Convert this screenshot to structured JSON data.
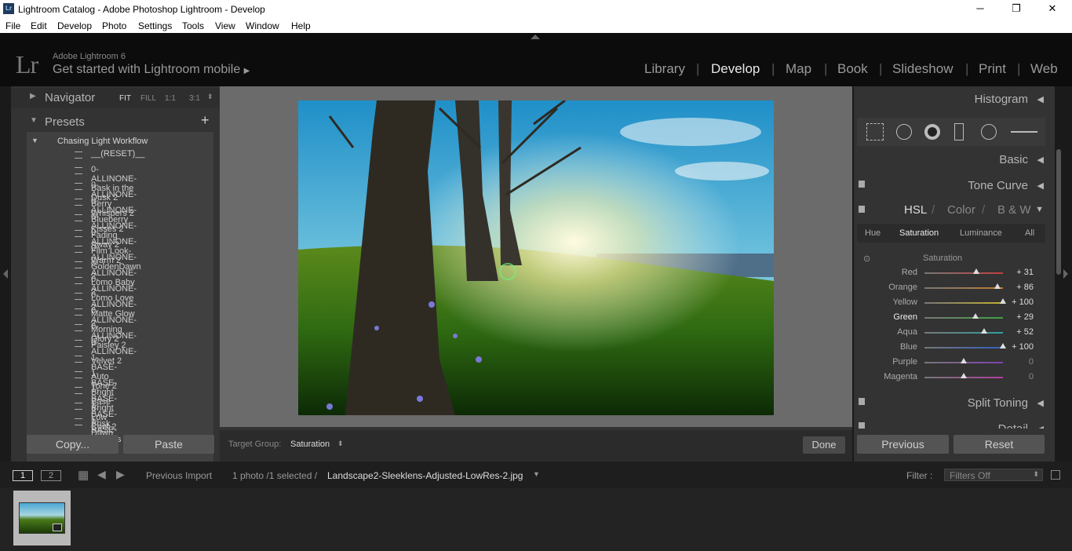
{
  "window": {
    "title": "Lightroom Catalog - Adobe Photoshop Lightroom - Develop",
    "min": "─",
    "max": "❐",
    "close": "✕"
  },
  "menu": [
    "File",
    "Edit",
    "Develop",
    "Photo",
    "Settings",
    "Tools",
    "View",
    "Window",
    "Help"
  ],
  "identity": {
    "logo": "Lr",
    "line1": "Adobe Lightroom 6",
    "line2": "Get started with Lightroom mobile",
    "arrow": "▶"
  },
  "modules": [
    "Library",
    "Develop",
    "Map",
    "Book",
    "Slideshow",
    "Print",
    "Web"
  ],
  "navigator": {
    "label": "Navigator",
    "zoom": [
      "FIT",
      "FILL",
      "1:1",
      "3:1"
    ]
  },
  "presets": {
    "label": "Presets",
    "add": "+",
    "folder": "Chasing Light Workflow",
    "items": [
      "__(RESET)__",
      "0-ALLINONE-Bask in the Dusk 2",
      "0-ALLINONE-Berry Whispers 2",
      "0-ALLINONE-Blueberry Kisses 2",
      "0-ALLINONE-Fading Away 2",
      "0-ALLINONE-Film Look-Warm 2",
      "0-ALLINONE-GoldenDawn 2",
      "0-ALLINONE-Lomo Baby 2",
      "0-ALLINONE-Lomo Love 2",
      "0-ALLINONE-Matte Glow 2",
      "0-ALLINONE-Morning Glory 2",
      "0-ALLINONE-Paisley 2",
      "0-ALLINONE-Velvet 2",
      "1-BASE-Auto Tone 2",
      "1-BASE-Bright Base 2",
      "1-BASE-Bright Low Cont 2",
      "1-BASE-Brisk Dawn 2",
      "1-BASE-Dreams 2"
    ]
  },
  "left_buttons": {
    "copy": "Copy...",
    "paste": "Paste"
  },
  "toolbar": {
    "target_label": "Target Group:",
    "target_value": "Saturation",
    "done": "Done"
  },
  "right": {
    "histogram": "Histogram",
    "basic": "Basic",
    "tone_curve": "Tone Curve",
    "hsl": {
      "hsl": "HSL",
      "color": "Color",
      "bw": "B & W",
      "sep": "/",
      "tabs": [
        "Hue",
        "Saturation",
        "Luminance",
        "All"
      ],
      "section": "Saturation",
      "sliders": [
        {
          "label": "Red",
          "value": "+ 31",
          "pos": 0.655,
          "color": "#c04040"
        },
        {
          "label": "Orange",
          "value": "+ 86",
          "pos": 0.93,
          "color": "#c07a30"
        },
        {
          "label": "Yellow",
          "value": "+ 100",
          "pos": 1.0,
          "color": "#c0b030"
        },
        {
          "label": "Green",
          "value": "+ 29",
          "pos": 0.645,
          "color": "#40a040"
        },
        {
          "label": "Aqua",
          "value": "+ 52",
          "pos": 0.76,
          "color": "#30a0a0"
        },
        {
          "label": "Blue",
          "value": "+ 100",
          "pos": 1.0,
          "color": "#3060c0"
        },
        {
          "label": "Purple",
          "value": "0",
          "pos": 0.5,
          "color": "#8040b0"
        },
        {
          "label": "Magenta",
          "value": "0",
          "pos": 0.5,
          "color": "#b040a0"
        }
      ]
    },
    "split_toning": "Split Toning",
    "detail": "Detail"
  },
  "right_buttons": {
    "previous": "Previous",
    "reset": "Reset"
  },
  "filmbar": {
    "page1": "1",
    "page2": "2",
    "source": "Previous Import",
    "count": "1 photo /1 selected /",
    "filename": "Landscape2-Sleeklens-Adjusted-LowRes-2.jpg",
    "filter_label": "Filter :",
    "filter_value": "Filters Off"
  }
}
